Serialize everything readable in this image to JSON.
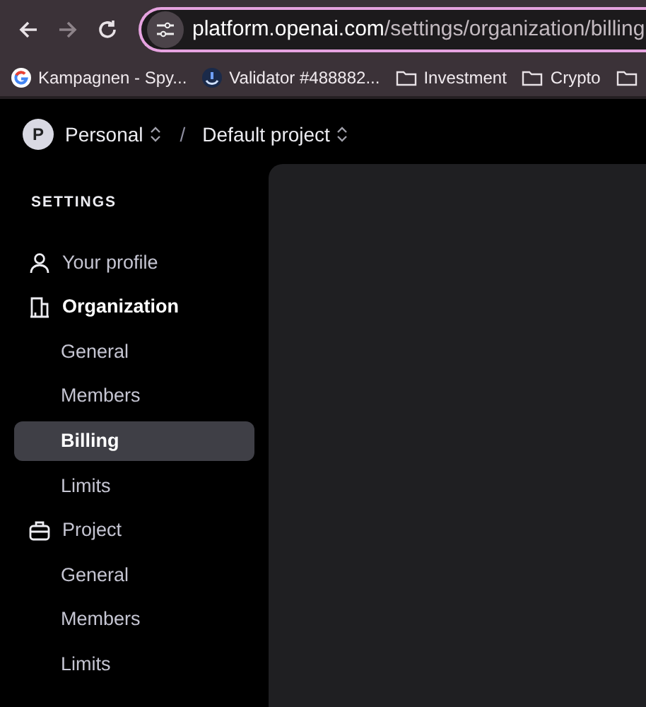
{
  "browser": {
    "url_host": "platform.openai.com",
    "url_path": "/settings/organization/billing",
    "bookmarks": [
      {
        "kind": "google",
        "label": "Kampagnen - Spy..."
      },
      {
        "kind": "site",
        "label": "Validator #488882..."
      },
      {
        "kind": "folder",
        "label": "Investment"
      },
      {
        "kind": "folder",
        "label": "Crypto"
      },
      {
        "kind": "folder"
      }
    ]
  },
  "header": {
    "avatar": "P",
    "organization": "Personal",
    "separator": "/",
    "project": "Default project"
  },
  "sidebar": {
    "title": "SETTINGS",
    "items": [
      {
        "kind": "section",
        "label": "Your profile",
        "current": false,
        "selected": false
      },
      {
        "kind": "section",
        "label": "Organization",
        "current": true,
        "selected": false
      },
      {
        "kind": "sub",
        "label": "General",
        "selected": false
      },
      {
        "kind": "sub",
        "label": "Members",
        "selected": false
      },
      {
        "kind": "sub",
        "label": "Billing",
        "selected": true
      },
      {
        "kind": "sub",
        "label": "Limits",
        "selected": false
      },
      {
        "kind": "section",
        "label": "Project",
        "current": false,
        "selected": false
      },
      {
        "kind": "sub",
        "label": "General",
        "selected": false
      },
      {
        "kind": "sub",
        "label": "Members",
        "selected": false
      },
      {
        "kind": "sub",
        "label": "Limits",
        "selected": false
      }
    ]
  }
}
